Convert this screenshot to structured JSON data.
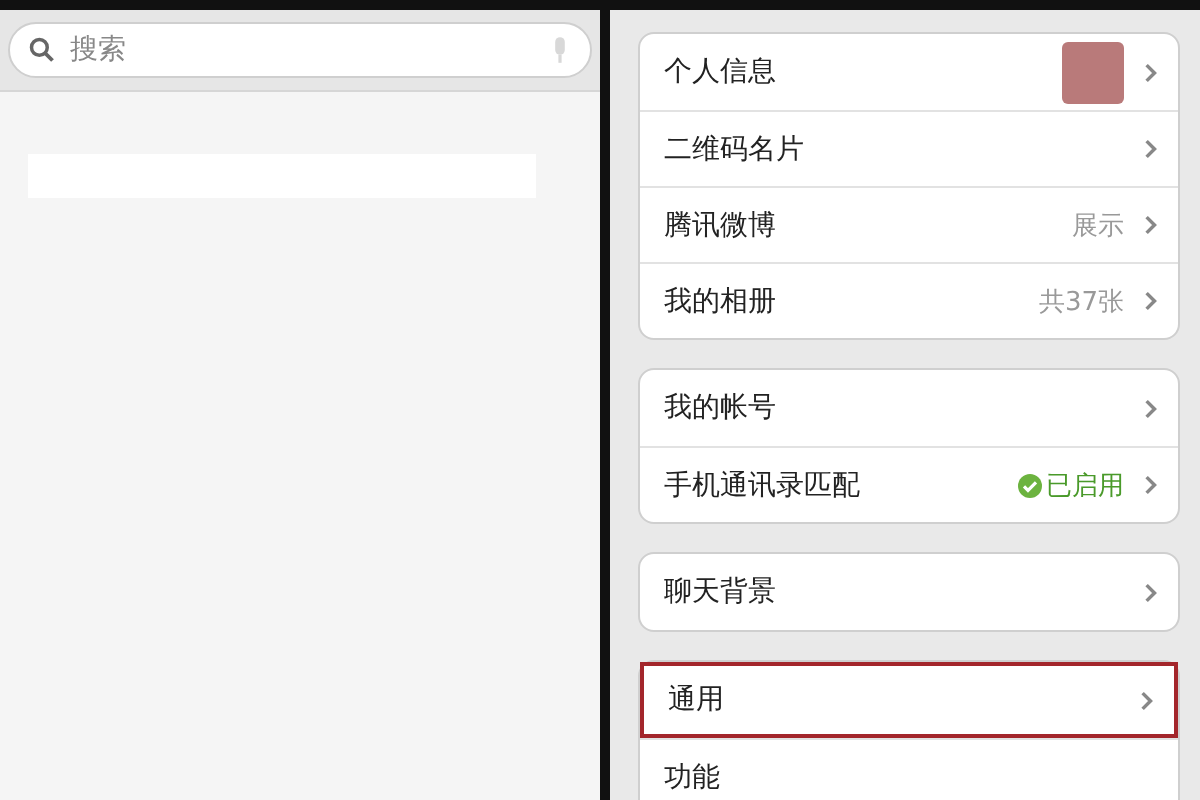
{
  "search": {
    "placeholder": "搜索"
  },
  "groups": [
    {
      "items": [
        {
          "label": "个人信息",
          "kind": "avatar",
          "highlighted": false
        },
        {
          "label": "二维码名片",
          "kind": "plain",
          "highlighted": false
        },
        {
          "label": "腾讯微博",
          "kind": "value",
          "value": "展示",
          "highlighted": false
        },
        {
          "label": "我的相册",
          "kind": "value",
          "value": "共37张",
          "highlighted": false
        }
      ]
    },
    {
      "items": [
        {
          "label": "我的帐号",
          "kind": "plain",
          "highlighted": false
        },
        {
          "label": "手机通讯录匹配",
          "kind": "status",
          "value": "已启用",
          "highlighted": false
        }
      ]
    },
    {
      "items": [
        {
          "label": "聊天背景",
          "kind": "plain",
          "highlighted": false
        }
      ]
    },
    {
      "items": [
        {
          "label": "通用",
          "kind": "plain",
          "highlighted": true
        },
        {
          "label": "功能",
          "kind": "bare",
          "highlighted": false
        }
      ]
    }
  ]
}
